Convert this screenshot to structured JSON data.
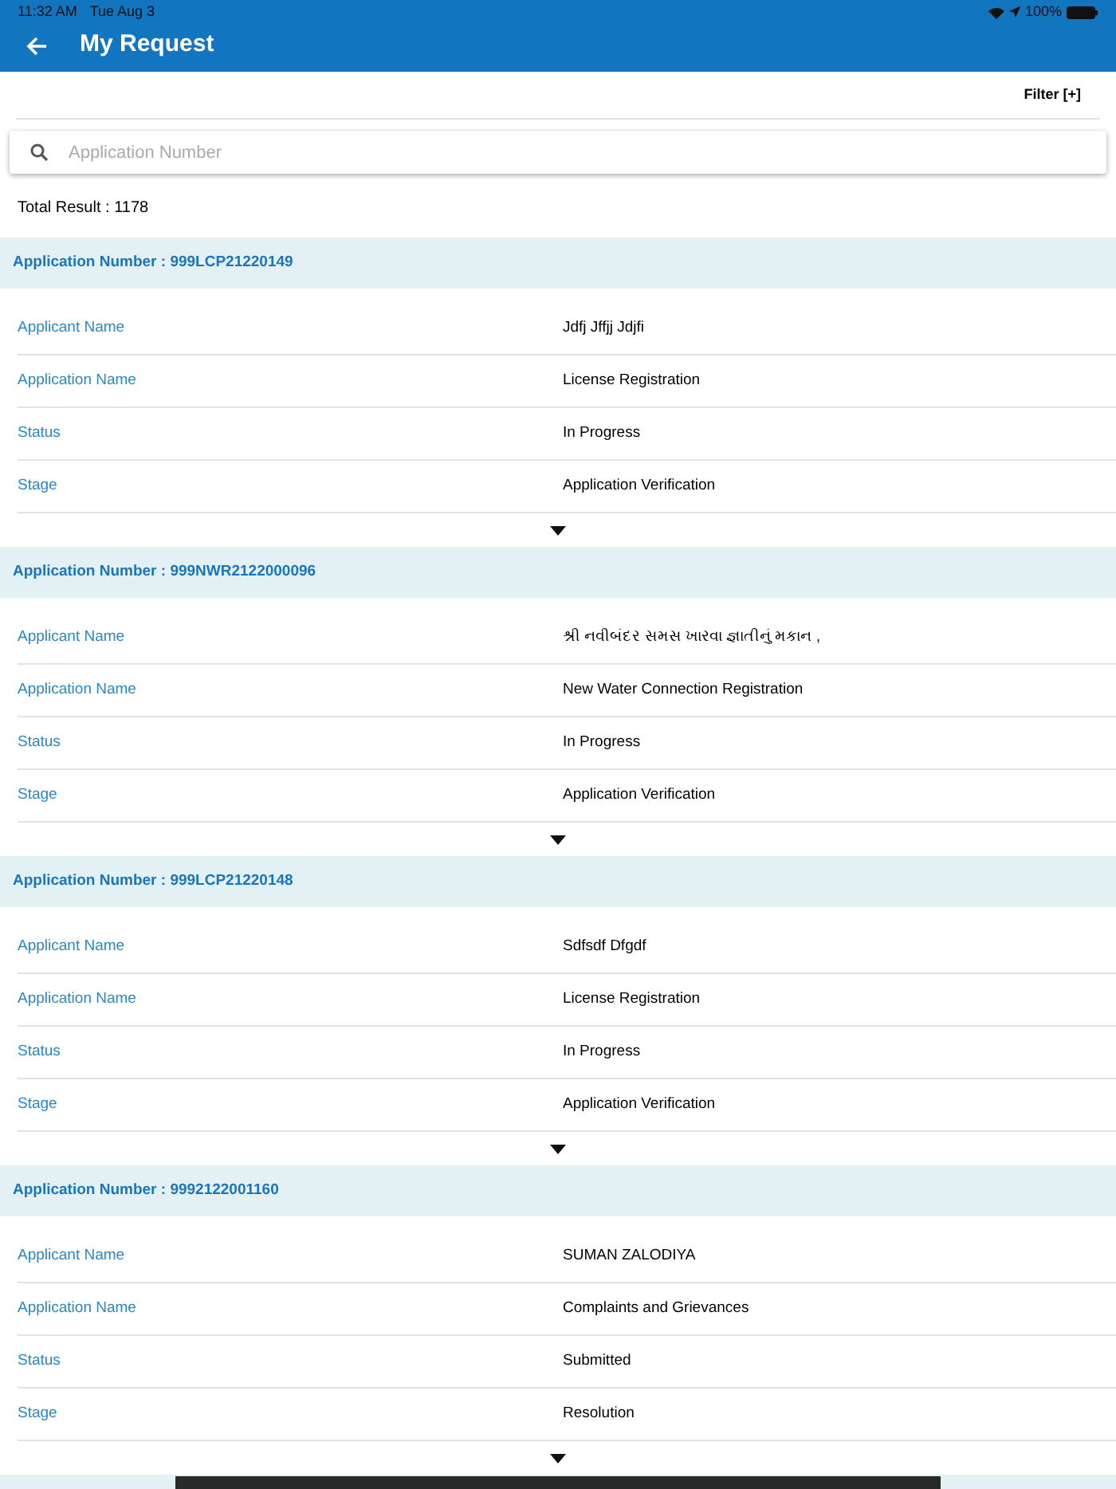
{
  "status_bar": {
    "time": "11:32 AM",
    "date": "Tue Aug 3",
    "battery": "100%"
  },
  "header": {
    "title": "My Request"
  },
  "filter": "Filter [+]",
  "search": {
    "placeholder": "Application Number"
  },
  "total": "Total Result : 1178",
  "requests": [
    {
      "number": "Application Number : 999LCP21220149",
      "fields": [
        {
          "label": "Applicant Name",
          "value": "Jdfj Jffjj Jdjfi"
        },
        {
          "label": "Application Name",
          "value": "License Registration"
        },
        {
          "label": "Status",
          "value": "In Progress"
        },
        {
          "label": "Stage",
          "value": "Application Verification"
        }
      ]
    },
    {
      "number": "Application Number : 999NWR2122000096",
      "fields": [
        {
          "label": "Applicant Name",
          "value": "શ્રી નવીબંદર સમસ ખારવા જ્ઞાતીનું મકાન ,"
        },
        {
          "label": "Application Name",
          "value": "New Water Connection Registration"
        },
        {
          "label": "Status",
          "value": "In Progress"
        },
        {
          "label": "Stage",
          "value": "Application Verification"
        }
      ]
    },
    {
      "number": "Application Number : 999LCP21220148",
      "fields": [
        {
          "label": "Applicant Name",
          "value": "Sdfsdf Dfgdf"
        },
        {
          "label": "Application Name",
          "value": "License Registration"
        },
        {
          "label": "Status",
          "value": "In Progress"
        },
        {
          "label": "Stage",
          "value": "Application Verification"
        }
      ]
    },
    {
      "number": "Application Number : 9992122001160",
      "fields": [
        {
          "label": "Applicant Name",
          "value": "SUMAN ZALODIYA"
        },
        {
          "label": "Application Name",
          "value": "Complaints and Grievances"
        },
        {
          "label": "Status",
          "value": "Submitted"
        },
        {
          "label": "Stage",
          "value": "Resolution"
        }
      ]
    }
  ]
}
